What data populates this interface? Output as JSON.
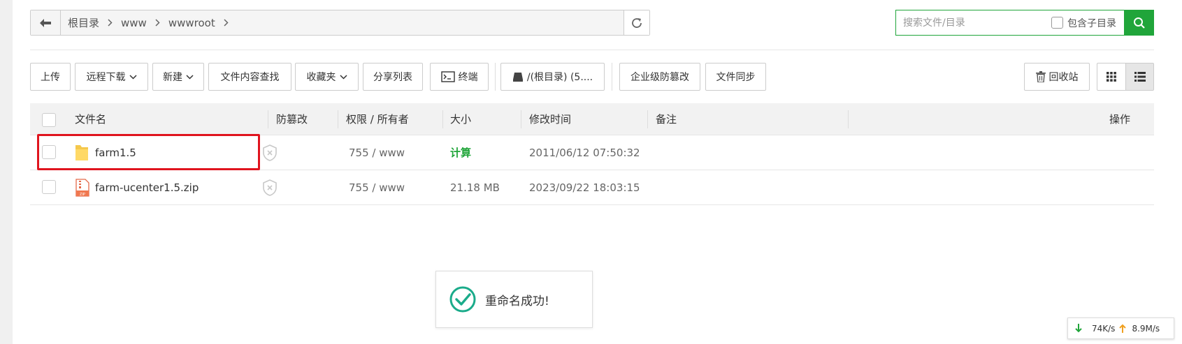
{
  "breadcrumb": {
    "items": [
      "根目录",
      "www",
      "wwwroot"
    ]
  },
  "search": {
    "placeholder": "搜索文件/目录",
    "subdir_label": "包含子目录"
  },
  "toolbar": {
    "upload": "上传",
    "remote_download": "远程下载",
    "new": "新建",
    "content_search": "文件内容查找",
    "favorites": "收藏夹",
    "share_list": "分享列表",
    "terminal": "终端",
    "disk": "/(根目录) (5....",
    "tamper_proof": "企业级防篡改",
    "file_sync": "文件同步",
    "recycle_bin": "回收站"
  },
  "table": {
    "columns": {
      "name": "文件名",
      "tamper": "防篡改",
      "perm": "权限 / 所有者",
      "size": "大小",
      "mtime": "修改时间",
      "note": "备注",
      "ops": "操作"
    },
    "rows": [
      {
        "name": "farm1.5",
        "type": "folder",
        "perm": "755 / www",
        "size": "计算",
        "mtime": "2011/06/12 07:50:32",
        "note": ""
      },
      {
        "name": "farm-ucenter1.5.zip",
        "type": "zip",
        "perm": "755 / www",
        "size": "21.18 MB",
        "mtime": "2023/09/22 18:03:15",
        "note": ""
      }
    ]
  },
  "toast": {
    "message": "重命名成功!"
  },
  "netspeed": {
    "down": "74K/s",
    "up": "8.9M/s"
  },
  "colors": {
    "accent": "#20a53a",
    "highlight": "#e0141e",
    "toast_check": "#1aab8a"
  },
  "icons": [
    "back-arrow-icon",
    "chevron-right-icon",
    "refresh-icon",
    "search-icon",
    "chevron-down-icon",
    "terminal-icon",
    "disk-icon",
    "trash-icon",
    "grid-view-icon",
    "list-view-icon",
    "folder-icon",
    "zip-file-icon",
    "shield-icon",
    "check-circle-icon",
    "arrow-down-icon",
    "arrow-up-icon"
  ]
}
